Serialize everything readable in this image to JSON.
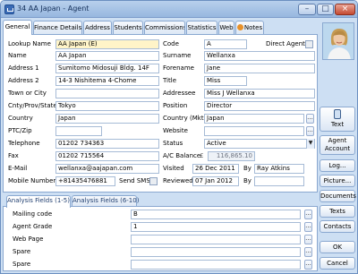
{
  "window": {
    "title": "34 AA Japan - Agent",
    "minimize": "–",
    "maximize": "□",
    "close": "×"
  },
  "tabs": [
    "General",
    "Finance Details",
    "Address",
    "Students",
    "Commissions",
    "Statistics",
    "Web",
    "Notes"
  ],
  "left": {
    "lookup_name": {
      "label": "Lookup Name",
      "value": "AA Japan (E)"
    },
    "name": {
      "label": "Name",
      "value": "AA Japan"
    },
    "address1": {
      "label": "Address 1",
      "value": "Sumitomo Midosuji Bldg. 14F"
    },
    "address2": {
      "label": "Address 2",
      "value": "14-3 Nishitema 4-Chome"
    },
    "town": {
      "label": "Town or City",
      "value": ""
    },
    "cnty": {
      "label": "Cnty/Prov/State",
      "value": "Tokyo"
    },
    "country": {
      "label": "Country",
      "value": "Japan"
    },
    "ptc": {
      "label": "PTC/Zip",
      "value": ""
    },
    "telephone": {
      "label": "Telephone",
      "value": "01202 734363"
    },
    "fax": {
      "label": "Fax",
      "value": "01202 715564"
    },
    "email": {
      "label": "E-Mail",
      "value": "wellanxa@aajapan.com"
    },
    "mobile": {
      "label": "Mobile Number",
      "value": "+81435476881"
    },
    "send_sms": "Send SMS"
  },
  "right": {
    "code": {
      "label": "Code",
      "value": "A"
    },
    "direct_agent": "Direct Agent",
    "surname": {
      "label": "Surname",
      "value": "Wellanxa"
    },
    "forename": {
      "label": "Forename",
      "value": "Jane"
    },
    "title": {
      "label": "Title",
      "value": "Miss"
    },
    "addressee": {
      "label": "Addressee",
      "value": "Miss J Wellanxa"
    },
    "position": {
      "label": "Position",
      "value": "Director"
    },
    "country_mkt": {
      "label": "Country (Mkt)",
      "value": "Japan"
    },
    "website": {
      "label": "Website",
      "value": ""
    },
    "status": {
      "label": "Status",
      "value": "Active"
    },
    "ac_balance": {
      "label": "A/C Balance",
      "currency": "£",
      "value": "116,865.10"
    },
    "visited": {
      "label": "Visited",
      "date": "26 Dec 2011",
      "by_label": "By",
      "by": "Ray Atkins"
    },
    "reviewed": {
      "label": "Reviewed",
      "date": "07 Jan 2012",
      "by_label": "By",
      "by": ""
    }
  },
  "bottom_tabs": [
    "Analysis Fields (1-5)",
    "Analysis Fields (6-10)"
  ],
  "analysis_fields": [
    {
      "label": "Mailing code",
      "value": "B"
    },
    {
      "label": "Agent Grade",
      "value": "1"
    },
    {
      "label": "Web Page",
      "value": ""
    },
    {
      "label": "Spare",
      "value": ""
    },
    {
      "label": "Spare",
      "value": ""
    }
  ],
  "side_buttons": {
    "text": "Text",
    "agent_account": "Agent Account",
    "log": "Log...",
    "picture": "Picture...",
    "documents": "Documents",
    "texts": "Texts",
    "contacts": "Contacts",
    "ok": "OK",
    "cancel": "Cancel"
  },
  "dots": "...",
  "drop_arrow": "▼",
  "colors": {
    "lookup_highlight": "#fff4c8",
    "window_bg": "#cddff3",
    "title_bar": "#97b7df"
  },
  "icons": [
    "app-icon",
    "notes-icon",
    "phone-icon",
    "dropdown-arrow-icon"
  ]
}
